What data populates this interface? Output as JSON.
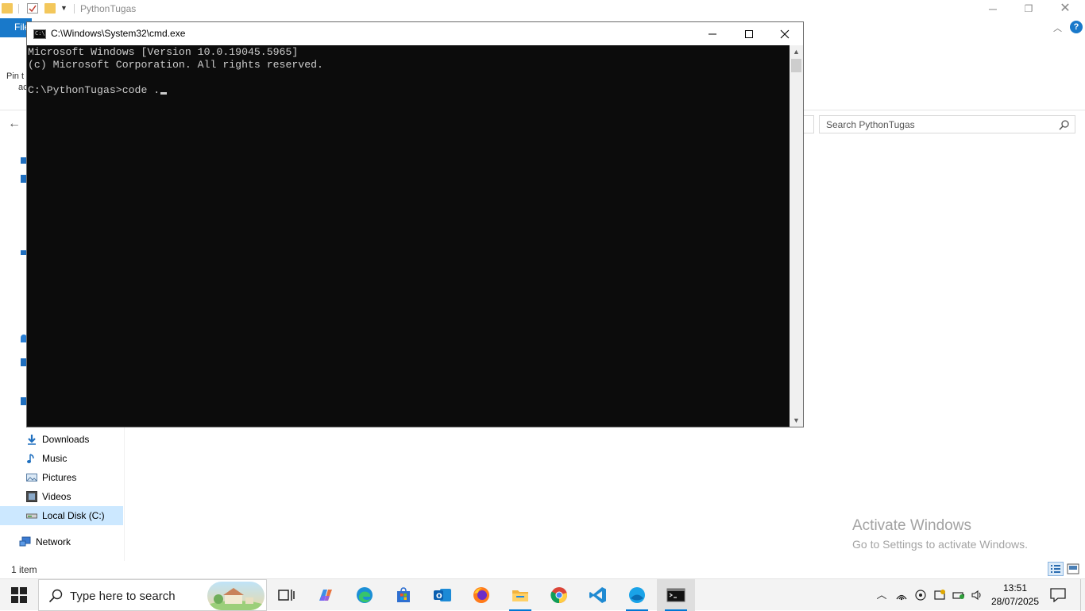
{
  "explorer": {
    "title": "PythonTugas",
    "file_tab": "File",
    "pin_text_1": "Pin t",
    "pin_text_2": "ac",
    "search_placeholder": "Search PythonTugas",
    "nav_items": [
      {
        "label": "Downloads",
        "icon": "downloads-icon"
      },
      {
        "label": "Music",
        "icon": "music-icon"
      },
      {
        "label": "Pictures",
        "icon": "pictures-icon"
      },
      {
        "label": "Videos",
        "icon": "videos-icon"
      },
      {
        "label": "Local Disk (C:)",
        "icon": "drive-icon",
        "selected": true
      },
      {
        "label": "Network",
        "icon": "network-icon"
      }
    ],
    "status": "1 item"
  },
  "cmd": {
    "title": "C:\\Windows\\System32\\cmd.exe",
    "lines": [
      "Microsoft Windows [Version 10.0.19045.5965]",
      "(c) Microsoft Corporation. All rights reserved.",
      "",
      "C:\\PythonTugas>code ."
    ]
  },
  "watermark": {
    "line1": "Activate Windows",
    "line2": "Go to Settings to activate Windows."
  },
  "taskbar": {
    "search_placeholder": "Type here to search",
    "apps": [
      "task-view",
      "copilot",
      "edge",
      "microsoft-store",
      "outlook",
      "firefox",
      "file-explorer",
      "chrome",
      "vscode",
      "app-blue",
      "cmd"
    ],
    "time": "13:51",
    "date": "28/07/2025"
  },
  "colors": {
    "accent": "#0078d4",
    "console_bg": "#0c0c0c",
    "console_fg": "#cccccc",
    "file_tab": "#1979ca",
    "selection": "#cce8ff"
  }
}
